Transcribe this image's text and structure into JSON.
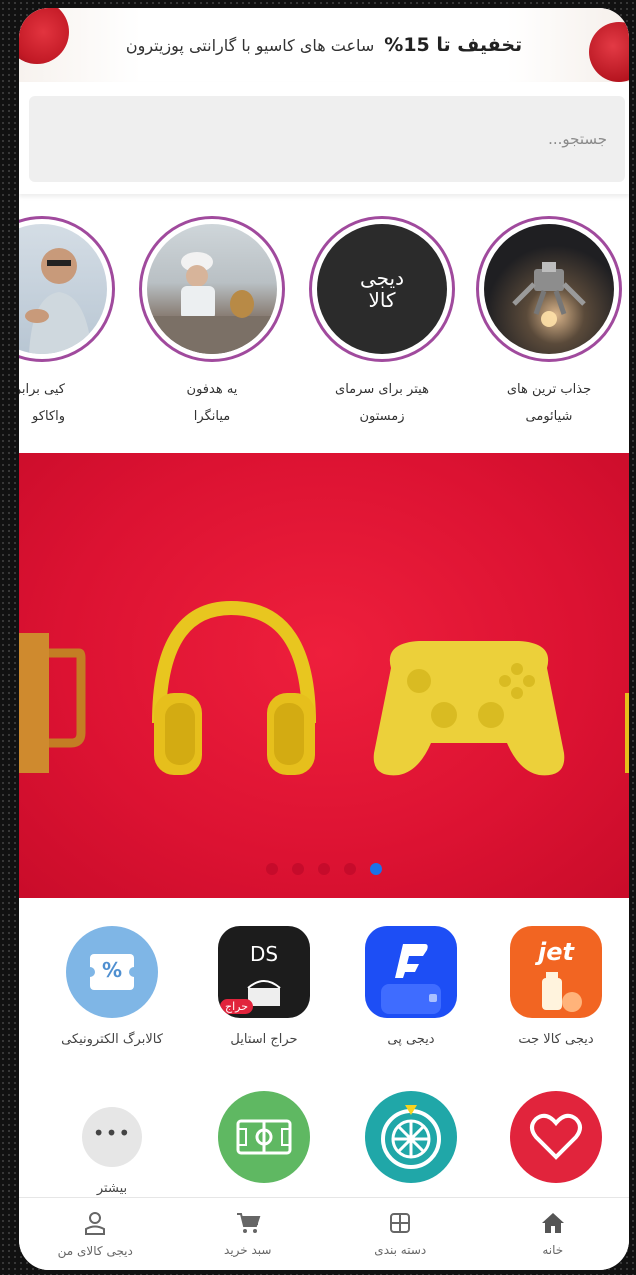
{
  "promo": {
    "bold": "تخفیف تا 15%",
    "text": "ساعت های کاسیو با گارانتی پوزیترون"
  },
  "search": {
    "placeholder": "جستجو..."
  },
  "stories": [
    {
      "line1": "جذاب ترین های",
      "line2": "شیائومی"
    },
    {
      "line1": "هیتر برای سرمای",
      "line2": "زمستون",
      "logo": "دیجی کالا"
    },
    {
      "line1": "یه هدفون",
      "line2": "میانگرا"
    },
    {
      "line1": "کیی برابر ا",
      "line2": "واکاکو"
    }
  ],
  "hero": {
    "slides_total": 5,
    "active_slide": 5
  },
  "services": [
    {
      "label": "دیجی کالا جت",
      "icon": "jet-icon",
      "icon_text": "jet",
      "color": "#f26522"
    },
    {
      "label": "دیجی پی",
      "icon": "digipay-icon",
      "color": "#1d4ef5"
    },
    {
      "label": "حراج استایل",
      "icon": "ds-sale-icon",
      "icon_text": "DS",
      "badge": "حراج",
      "color": "#1c1c1c"
    },
    {
      "label": "کالابرگ الکترونیکی",
      "icon": "voucher-icon",
      "icon_text": "%",
      "color": "#7fb6e6"
    },
    {
      "label": "",
      "icon": "heart-icon",
      "color": "#e1243c"
    },
    {
      "label": "",
      "icon": "wheel-icon",
      "color": "#20a7a8"
    },
    {
      "label": "",
      "icon": "football-field-icon",
      "color": "#5fb862"
    },
    {
      "label": "بیشتر",
      "icon": "more-icon",
      "color": "#e6e6e6"
    }
  ],
  "bottom_nav": [
    {
      "label": "خانه",
      "icon": "home-icon",
      "color": "#555"
    },
    {
      "label": "دسته بندی",
      "icon": "category-icon",
      "color": "#777"
    },
    {
      "label": "سبد خرید",
      "icon": "cart-icon",
      "color": "#777"
    },
    {
      "label": "دیجی کالای من",
      "icon": "user-icon",
      "color": "#777"
    }
  ]
}
